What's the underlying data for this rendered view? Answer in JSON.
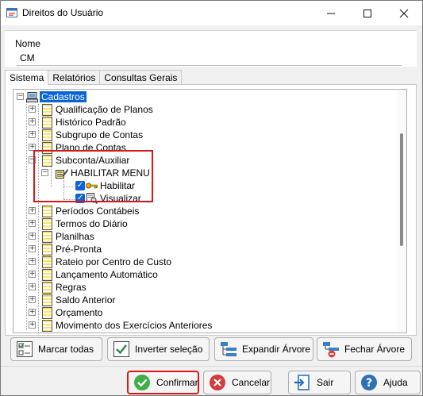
{
  "window": {
    "title": "Direitos do Usuário"
  },
  "name_field": {
    "label": "Nome",
    "value": "CM"
  },
  "tabs": [
    {
      "label": "Sistema",
      "active": true
    },
    {
      "label": "Relatórios",
      "active": false
    },
    {
      "label": "Consultas Gerais",
      "active": false
    }
  ],
  "tree": {
    "root": "Cadastros",
    "items": [
      "Qualificação de Planos",
      "Histórico Padrão",
      "Subgrupo de Contas",
      "Plano de Contas",
      "Subconta/Auxiliar",
      "HABILITAR MENU",
      "Habilitar",
      "Visualizar",
      "Períodos Contábeis",
      "Termos do Diário",
      "Planilhas",
      "Pré-Pronta",
      "Rateio por Centro de Custo",
      "Lançamento Automático",
      "Regras",
      "Saldo Anterior",
      "Orçamento",
      "Movimento dos Exercícios Anteriores"
    ]
  },
  "toolbar": {
    "mark_all": "Marcar todas",
    "invert": "Inverter seleção",
    "expand": "Expandir Árvore",
    "collapse": "Fechar Árvore"
  },
  "footer": {
    "confirm": "Confirmar",
    "cancel": "Cancelar",
    "exit": "Sair",
    "help": "Ajuda"
  },
  "colors": {
    "selection": "#0a64d8",
    "highlight": "#d21a1a",
    "checkbox": "#1062d8"
  }
}
